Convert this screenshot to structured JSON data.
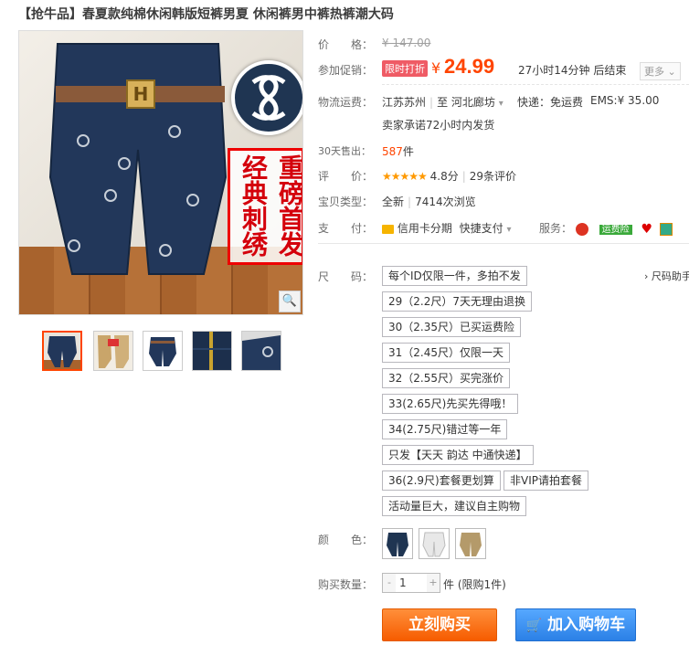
{
  "title": "【抢牛品】春夏款纯棉休闲韩版短裤男夏 休闲裤男中裤热裤潮大码",
  "gallery": {
    "overlay_text_left": "重磅首发",
    "overlay_text_right": "经典刺绣",
    "thumbnails_count": 5,
    "selected_index": 0
  },
  "price": {
    "label": "价　　格：",
    "original": "¥ 147.00"
  },
  "promo": {
    "label": "参加促销：",
    "tag": "限时打折",
    "currency": "¥",
    "value": "24.99",
    "countdown": "27小时14分钟 后结束",
    "more": "更多"
  },
  "shipping": {
    "label": "物流运费：",
    "from": "江苏苏州",
    "to_prefix": "至",
    "to": "河北廊坊",
    "express": "快递：免运费",
    "ems": "EMS:¥ 35.00",
    "promise": "卖家承诺72小时内发货"
  },
  "sales": {
    "label": "30天售出：",
    "count": "587",
    "unit": "件"
  },
  "rating": {
    "label": "评　　价：",
    "stars": "★★★★★",
    "score": "4.8分",
    "reviews": "29条评价"
  },
  "item_type": {
    "label": "宝贝类型：",
    "condition": "全新",
    "views": "7414次浏览"
  },
  "payment": {
    "label": "支　　付：",
    "credit": "信用卡分期",
    "quick": "快捷支付",
    "service_label": "服务：",
    "shipping_insurance": "运费险"
  },
  "size": {
    "label": "尺　　码：",
    "guide": "› 尺码助手",
    "options": [
      "每个ID仅限一件，多拍不发",
      "29（2.2尺）7天无理由退换",
      "30（2.35尺）已买运费险",
      "31（2.45尺）仅限一天",
      "32（2.55尺）买完涨价",
      "33(2.65尺)先买先得哦！",
      "34(2.75尺)错过等一年",
      "只发【天天 韵达 中通快递】",
      "36(2.9尺)套餐更划算",
      "非VIP请拍套餐",
      "活动量巨大，建议自主购物"
    ]
  },
  "color": {
    "label": "颜　　色：",
    "swatches": [
      "#1f3552",
      "#e8e8e8",
      "#b49a6a"
    ]
  },
  "quantity": {
    "label": "购买数量：",
    "minus": "-",
    "value": "1",
    "plus": "+",
    "unit": "件",
    "limit": "(限购1件)"
  },
  "buttons": {
    "buy": "立刻购买",
    "cart": "加入购物车"
  }
}
